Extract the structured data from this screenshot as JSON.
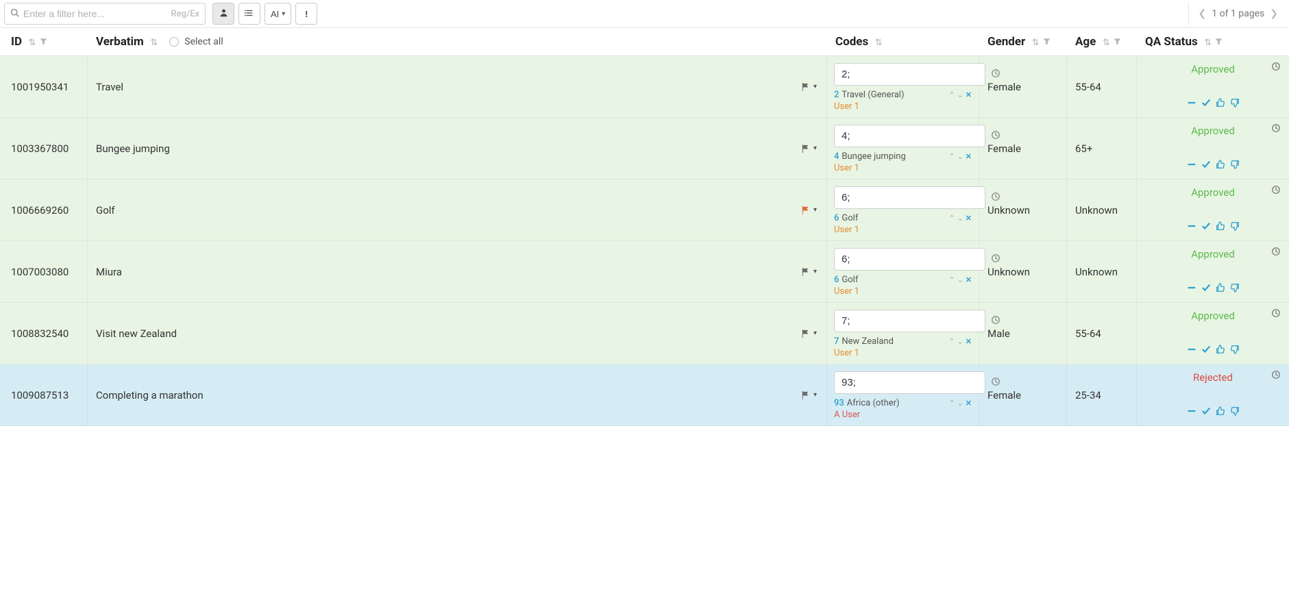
{
  "toolbar": {
    "filter_placeholder": "Enter a filter here...",
    "regex_label": "Reg/Ex",
    "ai_label": "AI",
    "pagination_text": "1 of 1 pages"
  },
  "headers": {
    "id": "ID",
    "verbatim": "Verbatim",
    "select_all": "Select all",
    "codes": "Codes",
    "gender": "Gender",
    "age": "Age",
    "qa_status": "QA Status"
  },
  "colors": {
    "approved_bg": "#e8f5e4",
    "rejected_bg": "#d6ecf5",
    "approved_text": "#5cb94e",
    "rejected_text": "#dc4a40",
    "accent": "#2f9fd0",
    "user_orange": "#e58b34",
    "user_red": "#d9534f"
  },
  "rows": [
    {
      "id": "1001950341",
      "verbatim": "Travel",
      "flag_red": false,
      "code_input": "2;",
      "code_num": "2",
      "code_label": "Travel (General)",
      "user": "User 1",
      "user_class": "user-orange",
      "gender": "Female",
      "age": "55-64",
      "status": "Approved",
      "status_class": "qa-approved",
      "row_class": "approved"
    },
    {
      "id": "1003367800",
      "verbatim": "Bungee jumping",
      "flag_red": false,
      "code_input": "4;",
      "code_num": "4",
      "code_label": "Bungee jumping",
      "user": "User 1",
      "user_class": "user-orange",
      "gender": "Female",
      "age": "65+",
      "status": "Approved",
      "status_class": "qa-approved",
      "row_class": "approved"
    },
    {
      "id": "1006669260",
      "verbatim": "Golf",
      "flag_red": true,
      "code_input": "6;",
      "code_num": "6",
      "code_label": "Golf",
      "user": "User 1",
      "user_class": "user-orange",
      "gender": "Unknown",
      "age": "Unknown",
      "status": "Approved",
      "status_class": "qa-approved",
      "row_class": "approved"
    },
    {
      "id": "1007003080",
      "verbatim": "Miura",
      "flag_red": false,
      "code_input": "6;",
      "code_num": "6",
      "code_label": "Golf",
      "user": "User 1",
      "user_class": "user-orange",
      "gender": "Unknown",
      "age": "Unknown",
      "status": "Approved",
      "status_class": "qa-approved",
      "row_class": "approved"
    },
    {
      "id": "1008832540",
      "verbatim": "Visit new Zealand",
      "flag_red": false,
      "code_input": "7;",
      "code_num": "7",
      "code_label": "New Zealand",
      "user": "User 1",
      "user_class": "user-orange",
      "gender": "Male",
      "age": "55-64",
      "status": "Approved",
      "status_class": "qa-approved",
      "row_class": "approved"
    },
    {
      "id": "1009087513",
      "verbatim": "Completing a marathon",
      "flag_red": false,
      "code_input": "93;",
      "code_num": "93",
      "code_label": "Africa (other)",
      "user": "A User",
      "user_class": "user-red",
      "gender": "Female",
      "age": "25-34",
      "status": "Rejected",
      "status_class": "qa-rejected",
      "row_class": "rejected"
    }
  ]
}
